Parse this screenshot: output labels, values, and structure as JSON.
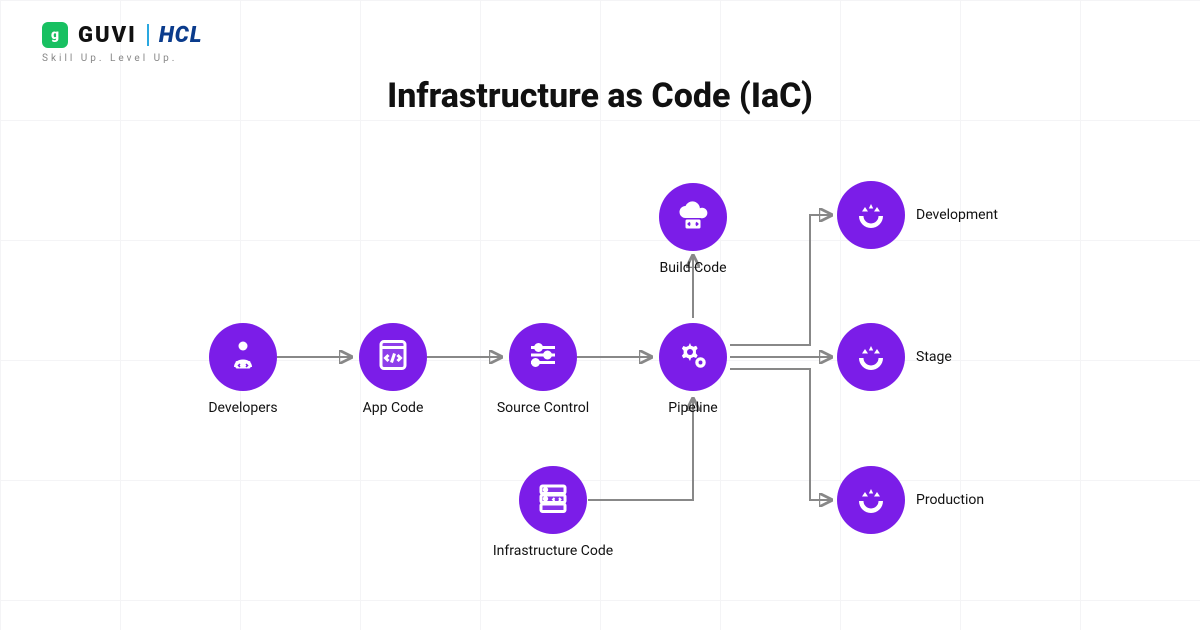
{
  "brand": {
    "guvi_mark": "g",
    "guvi_text": "GUVI",
    "hcl_text": "HCL",
    "tagline": "Skill Up. Level Up."
  },
  "title": "Infrastructure as Code (IaC)",
  "nodes": {
    "developers": "Developers",
    "app_code": "App Code",
    "source_control": "Source Control",
    "pipeline": "Pipeline",
    "build_code": "Build Code",
    "infra_code": "Infrastructure Code",
    "development": "Development",
    "stage": "Stage",
    "production": "Production"
  },
  "colors": {
    "node_bg": "#7b1de8",
    "accent_green": "#18c061",
    "hcl_blue": "#0a3b8c",
    "divider": "#2aa8e0",
    "arrow": "#888888"
  }
}
